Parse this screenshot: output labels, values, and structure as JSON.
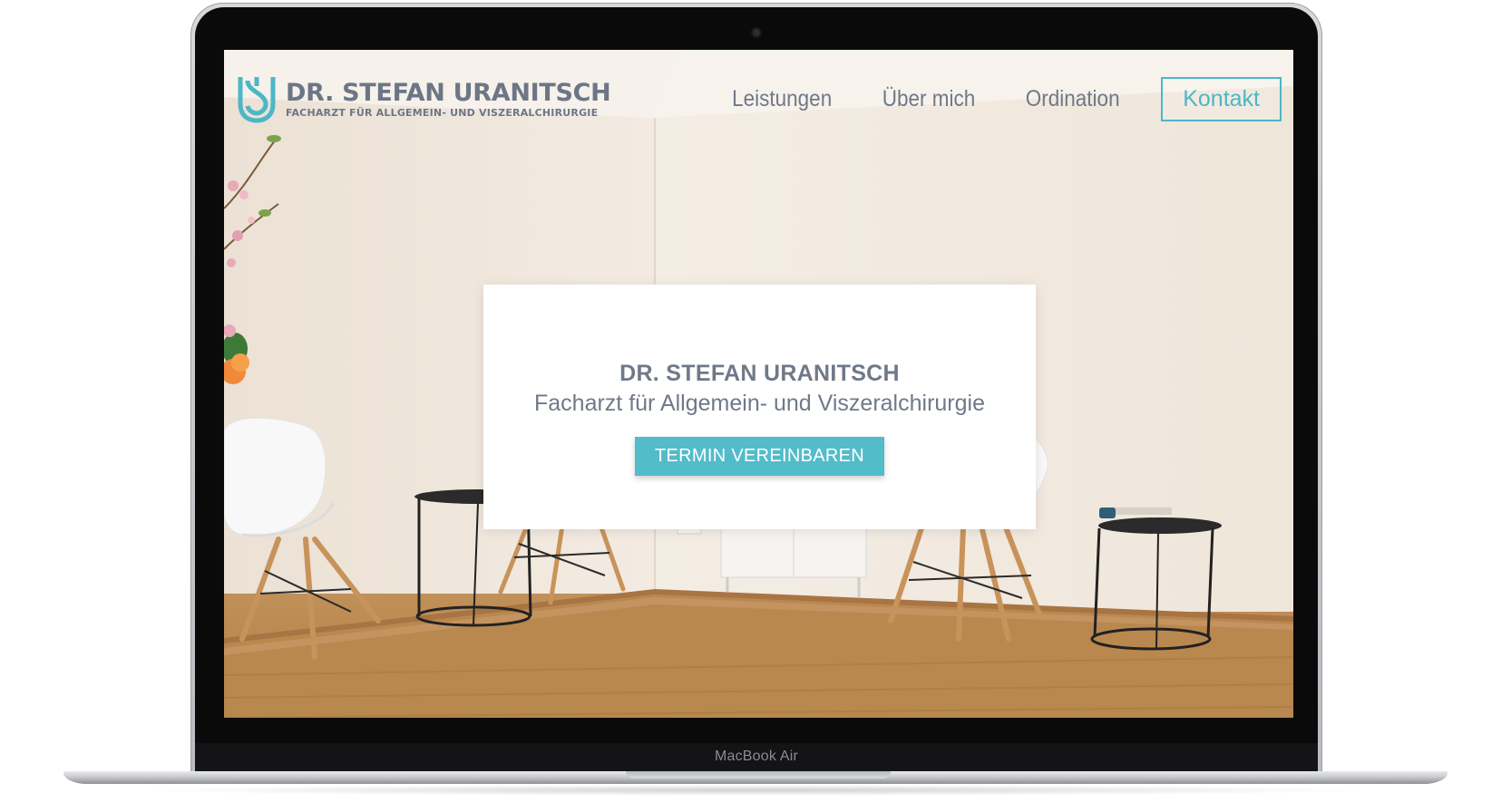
{
  "device": {
    "model_label": "MacBook Air"
  },
  "site": {
    "logo": {
      "name": "DR. STEFAN URANITSCH",
      "tagline": "FACHARZT FÜR ALLGEMEIN- UND VISZERALCHIRURGIE",
      "icon": "monogram-su-icon"
    },
    "nav": {
      "items": [
        {
          "label": "Leistungen"
        },
        {
          "label": "Über mich"
        },
        {
          "label": "Ordination"
        }
      ],
      "cta_label": "Kontakt"
    },
    "hero": {
      "title": "DR. STEFAN URANITSCH",
      "subtitle": "Facharzt für Allgemein- und Viszeralchirurgie",
      "button_label": "TERMIN VEREINBAREN"
    }
  },
  "colors": {
    "accent": "#4cb7c6",
    "button": "#53bcc9",
    "text": "#6f7988"
  }
}
